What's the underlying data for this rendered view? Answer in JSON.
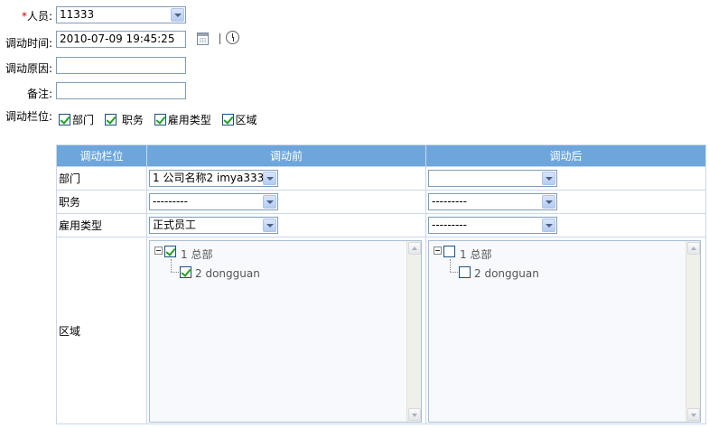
{
  "form": {
    "required_mark": "*",
    "person_label": "人员:",
    "person_value": "11333",
    "time_label": "调动时间:",
    "time_value": "2010-07-09 19:45:25",
    "reason_label": "调动原因:",
    "reason_value": "",
    "note_label": "备注:",
    "note_value": "",
    "columns_label": "调动栏位:",
    "column_options": [
      {
        "label": "部门",
        "checked": true
      },
      {
        "label": "职务",
        "checked": true
      },
      {
        "label": "雇用类型",
        "checked": true
      },
      {
        "label": "区域",
        "checked": true
      }
    ]
  },
  "table": {
    "headers": [
      "调动栏位",
      "调动前",
      "调动后"
    ],
    "rows": [
      {
        "label": "部门",
        "before": "1 公司名称2 imya333",
        "after": ""
      },
      {
        "label": "职务",
        "before": "---------",
        "after": "---------"
      },
      {
        "label": "雇用类型",
        "before": "正式员工",
        "after": "---------"
      },
      {
        "label": "区域"
      }
    ],
    "tree_before": {
      "root": {
        "label": "1 总部",
        "checked": true
      },
      "child": {
        "label": "2 dongguan",
        "checked": true
      }
    },
    "tree_after": {
      "root": {
        "label": "1 总部",
        "checked": false
      },
      "child": {
        "label": "2 dongguan",
        "checked": false
      }
    }
  },
  "colors": {
    "header_bg": "#6ea6dc",
    "required": "#cc0000",
    "check": "#21a121"
  }
}
